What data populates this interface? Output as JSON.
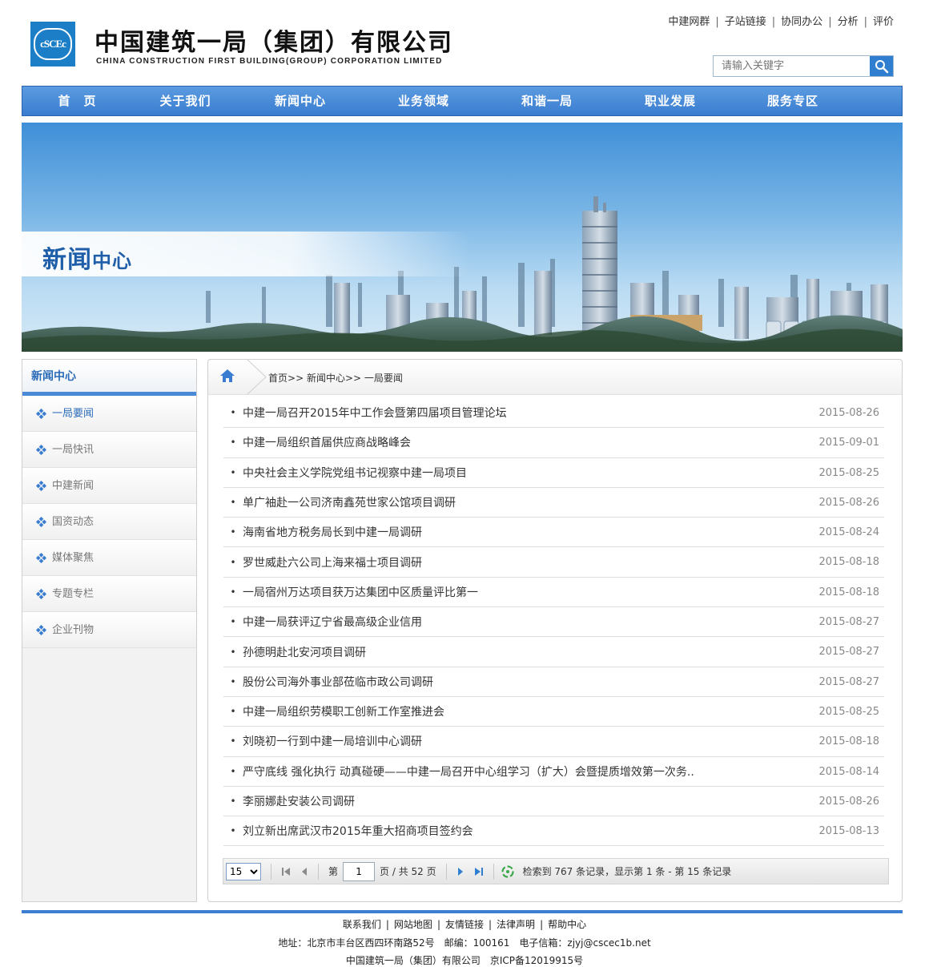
{
  "header": {
    "logo_text": "cSCEc",
    "company_cn": "中国建筑一局（集团）有限公司",
    "company_en": "CHINA CONSTRUCTION FIRST BUILDING(GROUP) CORPORATION LIMITED",
    "top_links": [
      "中建网群",
      "子站链接",
      "协同办公",
      "分析",
      "评价"
    ],
    "search": {
      "placeholder": "请输入关键字"
    }
  },
  "nav": {
    "items": [
      "首　页",
      "关于我们",
      "新闻中心",
      "业务领域",
      "和谐一局",
      "职业发展",
      "服务专区"
    ]
  },
  "banner": {
    "title_big": "新闻",
    "title_small": "中心"
  },
  "sidebar": {
    "title": "新闻中心",
    "items": [
      {
        "label": "一局要闻",
        "active": true
      },
      {
        "label": "一局快讯",
        "active": false
      },
      {
        "label": "中建新闻",
        "active": false
      },
      {
        "label": "国资动态",
        "active": false
      },
      {
        "label": "媒体聚焦",
        "active": false
      },
      {
        "label": "专题专栏",
        "active": false
      },
      {
        "label": "企业刊物",
        "active": false
      }
    ]
  },
  "breadcrumb": {
    "home": "首页",
    "section": "新闻中心",
    "current": "一局要闻",
    "sep": ">>"
  },
  "news": [
    {
      "title": "中建一局召开2015年中工作会暨第四届项目管理论坛",
      "date": "2015-08-26"
    },
    {
      "title": "中建一局组织首届供应商战略峰会",
      "date": "2015-09-01"
    },
    {
      "title": "中央社会主义学院党组书记视察中建一局项目",
      "date": "2015-08-25"
    },
    {
      "title": "单广袖赴一公司济南鑫苑世家公馆项目调研",
      "date": "2015-08-26"
    },
    {
      "title": "海南省地方税务局长到中建一局调研",
      "date": "2015-08-24"
    },
    {
      "title": "罗世威赴六公司上海来福士项目调研",
      "date": "2015-08-18"
    },
    {
      "title": "一局宿州万达项目获万达集团中区质量评比第一",
      "date": "2015-08-18"
    },
    {
      "title": "中建一局获评辽宁省最高级企业信用",
      "date": "2015-08-27"
    },
    {
      "title": "孙德明赴北安河项目调研",
      "date": "2015-08-27"
    },
    {
      "title": "股份公司海外事业部莅临市政公司调研",
      "date": "2015-08-27"
    },
    {
      "title": "中建一局组织劳模职工创新工作室推进会",
      "date": "2015-08-25"
    },
    {
      "title": "刘晓初一行到中建一局培训中心调研",
      "date": "2015-08-18"
    },
    {
      "title": "严守底线 强化执行 动真碰硬——中建一局召开中心组学习（扩大）会暨提质增效第一次务..",
      "date": "2015-08-14"
    },
    {
      "title": "李丽娜赴安装公司调研",
      "date": "2015-08-26"
    },
    {
      "title": "刘立新出席武汉市2015年重大招商项目签约会",
      "date": "2015-08-13"
    }
  ],
  "pager": {
    "page_size": "15",
    "page_prefix": "第",
    "current_page": "1",
    "page_suffix": "页 / 共 52 页",
    "summary": "检索到 767 条记录，显示第 1 条 - 第 15 条记录"
  },
  "footer": {
    "links": [
      "联系我们",
      "网站地图",
      "友情链接",
      "法律声明",
      "帮助中心"
    ],
    "address": "地址：北京市丰台区西四环南路52号　邮编：100161　电子信箱：zjyj@cscec1b.net",
    "copyright": "中国建筑一局（集团）有限公司　京ICP备12019915号"
  },
  "colors": {
    "accent": "#3a7dd0",
    "nav_top": "#5b9be0",
    "active_text": "#2a6bb8"
  }
}
